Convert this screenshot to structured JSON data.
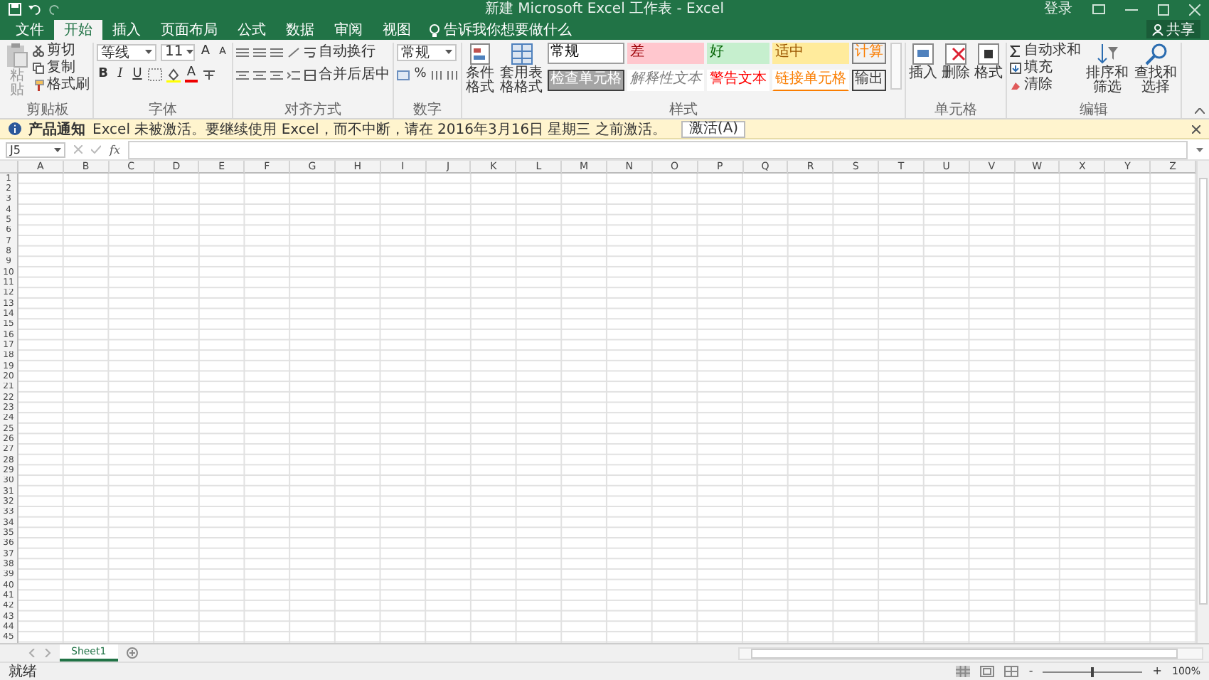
{
  "title_bar": {
    "title": "新建 Microsoft Excel 工作表 - Excel",
    "sign_in": "登录"
  },
  "tabs": [
    {
      "label": "文件",
      "selected": false
    },
    {
      "label": "开始",
      "selected": true
    },
    {
      "label": "插入",
      "selected": false
    },
    {
      "label": "页面布局",
      "selected": false
    },
    {
      "label": "公式",
      "selected": false
    },
    {
      "label": "数据",
      "selected": false
    },
    {
      "label": "审阅",
      "selected": false
    },
    {
      "label": "视图",
      "selected": false
    }
  ],
  "tell_me": "告诉我你想要做什么",
  "share": "共享",
  "ribbon": {
    "clipboard": {
      "paste": "粘贴",
      "paste_disabled": true,
      "cut": "剪切",
      "copy": "复制",
      "format_painter": "格式刷",
      "label": "剪贴板"
    },
    "font": {
      "name": "等线",
      "size": "11",
      "grow": "A",
      "shrink": "A",
      "bold": "B",
      "italic": "I",
      "underline": "U",
      "font_color": "A",
      "label": "字体"
    },
    "alignment": {
      "wrap": "自动换行",
      "merge": "合并后居中",
      "label": "对齐方式"
    },
    "number": {
      "format": "常规",
      "percent": "%",
      "label": "数字"
    },
    "conditional": "条件格式",
    "table_format": "套用表格格式",
    "styles": {
      "items": [
        {
          "label": "常规",
          "kind": "normal"
        },
        {
          "label": "差",
          "kind": "bad"
        },
        {
          "label": "好",
          "kind": "good"
        },
        {
          "label": "适中",
          "kind": "neutral"
        },
        {
          "label": "计算",
          "kind": "calculation"
        },
        {
          "label": "检查单元格",
          "kind": "check"
        },
        {
          "label": "解释性文本",
          "kind": "explanatory"
        },
        {
          "label": "警告文本",
          "kind": "warning"
        },
        {
          "label": "链接单元格",
          "kind": "linked"
        },
        {
          "label": "输出",
          "kind": "output"
        }
      ],
      "label": "样式"
    },
    "cells": {
      "insert": "插入",
      "delete": "删除",
      "format": "格式",
      "label": "单元格"
    },
    "editing": {
      "autosum": "自动求和",
      "fill": "填充",
      "clear": "清除",
      "sort": "排序和筛选",
      "find": "查找和选择",
      "label": "编辑"
    }
  },
  "info_bar": {
    "title": "产品通知",
    "message": "Excel 未被激活。要继续使用 Excel，而不中断，请在 2016年3月16日 星期三 之前激活。",
    "button": "激活(A)"
  },
  "formula_bar": {
    "name_box": "J5",
    "fx": "fx"
  },
  "columns": [
    "A",
    "B",
    "C",
    "D",
    "E",
    "F",
    "G",
    "H",
    "I",
    "J",
    "K",
    "L",
    "M",
    "N",
    "O",
    "P",
    "Q",
    "R",
    "S",
    "T",
    "U",
    "V",
    "W",
    "X",
    "Y",
    "Z"
  ],
  "rows": [
    "1",
    "2",
    "3",
    "4",
    "5",
    "6",
    "7",
    "8",
    "9",
    "10",
    "11",
    "12",
    "13",
    "14",
    "15",
    "16",
    "17",
    "18",
    "19",
    "20",
    "21",
    "22",
    "23",
    "24",
    "25",
    "26",
    "27",
    "28",
    "29",
    "30",
    "31",
    "32",
    "33",
    "34",
    "35",
    "36",
    "37",
    "38",
    "39",
    "40",
    "41",
    "42",
    "43",
    "44",
    "45"
  ],
  "sheet_tabs": [
    {
      "label": "Sheet1",
      "selected": true
    }
  ],
  "status_bar": {
    "status": "就绪",
    "zoom_out": "-",
    "zoom_in": "+",
    "zoom": "100%",
    "zoom_slider": {
      "level": 0.5
    }
  }
}
